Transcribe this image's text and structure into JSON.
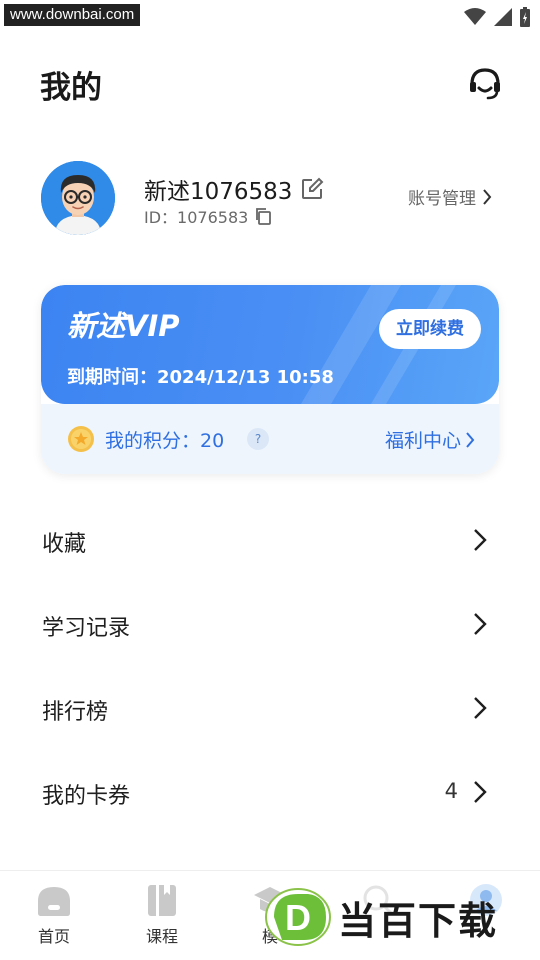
{
  "status_bar": {
    "watermark_text": "www.downbai.com",
    "icons": [
      "wifi-icon",
      "signal-icon",
      "battery-icon"
    ]
  },
  "header": {
    "title": "我的",
    "support_icon": "headset-icon"
  },
  "profile": {
    "username": "新述1076583",
    "user_id": "ID：1076583",
    "account_link": "账号管理"
  },
  "vip": {
    "title": "新述VIP",
    "expiry": "到期时间：2024/12/13 10:58",
    "renew_label": "立即续费",
    "points_label": "我的积分：20",
    "help_label": "?",
    "welfare_label": "福利中心"
  },
  "menu": {
    "items": [
      {
        "label": "收藏",
        "count": ""
      },
      {
        "label": "学习记录",
        "count": ""
      },
      {
        "label": "排行榜",
        "count": ""
      },
      {
        "label": "我的卡券",
        "count": "4"
      }
    ]
  },
  "tabbar": {
    "tabs": [
      {
        "label": "首页",
        "icon": "home-icon"
      },
      {
        "label": "课程",
        "icon": "book-icon"
      },
      {
        "label": "模",
        "icon": "graduation-icon"
      },
      {
        "label": "",
        "icon": "search-icon"
      },
      {
        "label": "",
        "icon": "profile-icon"
      }
    ]
  },
  "brand_watermark": {
    "letter": "D",
    "text": "当百下载"
  },
  "colors": {
    "accent": "#2f6fe0",
    "vip_gradient_start": "#3c84f2",
    "vip_gradient_end": "#5aa6f8",
    "points_bg": "#eef5fd"
  }
}
